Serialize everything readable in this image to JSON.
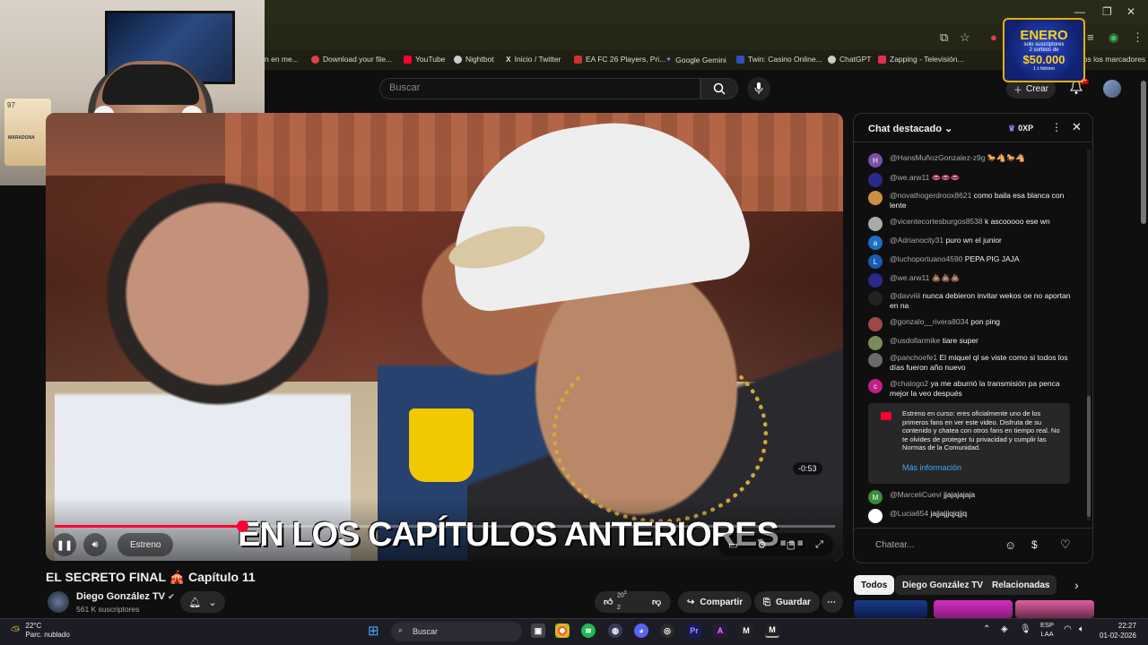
{
  "browser": {
    "bookmarks": [
      {
        "label": "n en me...",
        "color": "#888888"
      },
      {
        "label": "Download your file...",
        "color": "#e04040"
      },
      {
        "label": "YouTube",
        "color": "#ff0033"
      },
      {
        "label": "Nightbot",
        "color": "#cccccc"
      },
      {
        "label": "Inicio / Twitter",
        "color": "#ffffff"
      },
      {
        "label": "EA FC 26 Players, Pri...",
        "color": "#d03030"
      },
      {
        "label": "Google Gemini",
        "color": "#6a8cff"
      },
      {
        "label": "Twin: Casino Online...",
        "color": "#3050c0"
      },
      {
        "label": "ChatGPT",
        "color": "#cccccc"
      },
      {
        "label": "Zapping - Televisión...",
        "color": "#e03050"
      },
      {
        "label": "dos los marcadores",
        "color": ""
      }
    ]
  },
  "promo": {
    "line1": "ENERO",
    "line2": "solo suscriptores",
    "line3": "2 sorteos de",
    "amount": "$50.000",
    "line5": "1 x febrero"
  },
  "webcam": {
    "card_rating": "97",
    "card_name": "MARADONA"
  },
  "youtube": {
    "search_placeholder": "Buscar",
    "create_label": "Crear",
    "notif_count": "9+"
  },
  "video": {
    "overlay_text": "EN LOS CAPÍTULOS ANTERIORES...",
    "remaining": "-0:53",
    "estreno_label": "Estreno",
    "progress_percent": 24,
    "title": "EL SECRETO FINAL 🎪 Capítulo 11",
    "channel": "Diego González TV",
    "subscribers": "561 K suscriptores",
    "likes_top": "20",
    "likes_sup": "3",
    "likes_bottom": "2",
    "share_label": "Compartir",
    "save_label": "Guardar"
  },
  "chat": {
    "title": "Chat destacado",
    "xp": "0XP",
    "messages": [
      {
        "author": "@HansMuñozGonzalez-z9g",
        "text": "🐎🐴🐎🐴",
        "avatar": "H",
        "color": "#7b4ea8"
      },
      {
        "author": "@we.arw11",
        "text": "👄👄👄",
        "avatar": "",
        "color": "#2a2a8a"
      },
      {
        "author": "@novathogerdroox8621",
        "text": "como baila esa blanca con lente",
        "avatar": "",
        "color": "#c89040"
      },
      {
        "author": "@vicentecortesburgos8538",
        "text": "k ascooooo ese wn",
        "avatar": "",
        "color": "#aaaaaa"
      },
      {
        "author": "@Adrianocity31",
        "text": "puro wn el junior",
        "avatar": "a",
        "color": "#1a70c0"
      },
      {
        "author": "@luchoportuano4590",
        "text": "PEPA PIG JAJA",
        "avatar": "L",
        "color": "#1a5ab0"
      },
      {
        "author": "@we.arw11",
        "text": "💩💩💩",
        "avatar": "",
        "color": "#2a2a8a"
      },
      {
        "author": "@davviiii",
        "text": "nunca debieron invitar wekos oe no aportan en na",
        "avatar": "",
        "color": "#222222"
      },
      {
        "author": "@gonzalo__rivera8034",
        "text": "pon ping",
        "avatar": "",
        "color": "#a04848"
      },
      {
        "author": "@usdollarmike",
        "text": "tiare super",
        "avatar": "",
        "color": "#7a8a5a"
      },
      {
        "author": "@panchoefe1",
        "text": "El miquel ql se viste como si todos los días fueron año nuevo",
        "avatar": "",
        "color": "#6a6a6a"
      },
      {
        "author": "@chalogo2",
        "text": "ya me aburrió la transmisión pa penca mejor la veo después",
        "avatar": "c",
        "color": "#c0208a"
      },
      {
        "author": "@MarceliCuevi",
        "text": "jjajajajaja",
        "avatar": "M",
        "color": "#3a8a3a"
      },
      {
        "author": "@Lucia654",
        "text": "jajjajjjqjqjjq",
        "avatar": "",
        "color": "#ffffff"
      }
    ],
    "notice_text": "Estreno en curso: eres oficialmente uno de los primeros fans en ver este video. Disfruta de su contenido y chatea con otros fans en tiempo real. No te olvides de proteger tu privacidad y cumplir las Normas de la Comunidad.",
    "notice_link": "Más información",
    "input_placeholder": "Chatear..."
  },
  "chips": [
    "Todos",
    "Diego González TV",
    "Relacionadas"
  ],
  "taskbar": {
    "temp": "22°C",
    "weather": "Parc. nublado",
    "search": "Buscar",
    "lang1": "ESP",
    "lang2": "LAA",
    "time": "22:27",
    "date": "01-02-2026"
  }
}
